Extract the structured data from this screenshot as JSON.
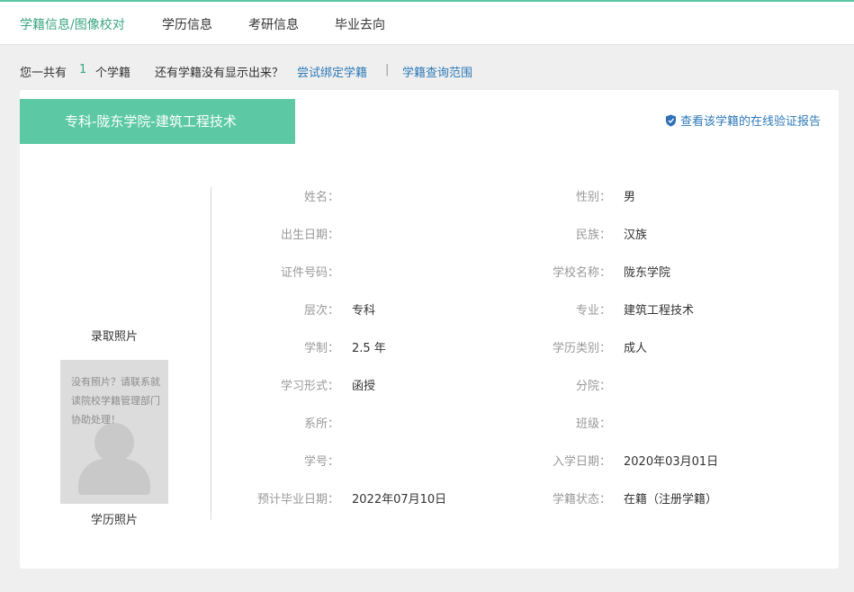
{
  "nav": {
    "tabs": [
      {
        "label": "学籍信息/图像校对",
        "active": true
      },
      {
        "label": "学历信息",
        "active": false
      },
      {
        "label": "考研信息",
        "active": false
      },
      {
        "label": "毕业去向",
        "active": false
      }
    ]
  },
  "summary": {
    "prefix": "您一共有",
    "count": "1",
    "suffix": "个学籍",
    "question": "还有学籍没有显示出来？",
    "bind_link": "尝试绑定学籍",
    "separator": "|",
    "scope_link": "学籍查询范围"
  },
  "record": {
    "title": "专科-陇东学院-建筑工程技术",
    "verify_link": "查看该学籍的在线验证报告",
    "photos": {
      "admission_label": "录取照片",
      "placeholder_text": "没有照片？请联系就读院校学籍管理部门协助处理！",
      "degree_label": "学历照片"
    },
    "left_fields": [
      {
        "label": "姓名：",
        "value": ""
      },
      {
        "label": "出生日期：",
        "value": ""
      },
      {
        "label": "证件号码：",
        "value": ""
      },
      {
        "label": "层次：",
        "value": "专科"
      },
      {
        "label": "学制：",
        "value": "2.5 年"
      },
      {
        "label": "学习形式：",
        "value": "函授"
      },
      {
        "label": "系所：",
        "value": ""
      },
      {
        "label": "学号：",
        "value": ""
      },
      {
        "label": "预计毕业日期：",
        "value": "2022年07月10日"
      }
    ],
    "right_fields": [
      {
        "label": "性别：",
        "value": "男"
      },
      {
        "label": "民族：",
        "value": "汉族"
      },
      {
        "label": "学校名称：",
        "value": "陇东学院"
      },
      {
        "label": "专业：",
        "value": "建筑工程技术"
      },
      {
        "label": "学历类别：",
        "value": "成人"
      },
      {
        "label": "分院：",
        "value": ""
      },
      {
        "label": "班级：",
        "value": ""
      },
      {
        "label": "入学日期：",
        "value": "2020年03月01日"
      },
      {
        "label": "学籍状态：",
        "value": "在籍（注册学籍）"
      }
    ]
  },
  "colors": {
    "accent": "#5cc9a4",
    "accent_text": "#3ba57f",
    "link": "#2e7ab8"
  }
}
